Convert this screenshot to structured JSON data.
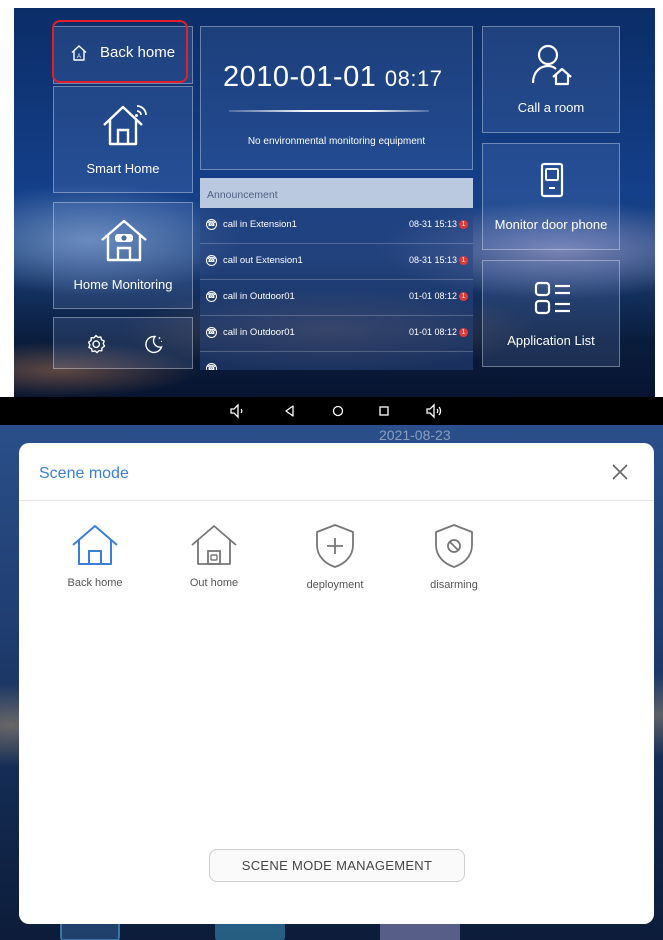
{
  "top": {
    "back_home_label": "Back home",
    "smart_home_label": "Smart Home",
    "home_monitoring_label": "Home Monitoring",
    "date": "2010-01-01",
    "time": "08:17",
    "env_message": "No environmental monitoring equipment",
    "announcement_header": "Announcement",
    "announcements": [
      {
        "text": "call in Extension1",
        "time": "08-31 15:13",
        "badge": "1"
      },
      {
        "text": "call out Extension1",
        "time": "08-31 15:13",
        "badge": "1"
      },
      {
        "text": "call in Outdoor01",
        "time": "01-01 08:12",
        "badge": "1"
      },
      {
        "text": "call in Outdoor01",
        "time": "01-01 08:12",
        "badge": "1"
      }
    ],
    "call_room_label": "Call a room",
    "monitor_label": "Monitor door phone",
    "app_list_label": "Application List",
    "highlight_color": "#e1202c"
  },
  "bottom": {
    "background_date": "2021-08-23",
    "dialog_title": "Scene mode",
    "scenes": [
      {
        "label": "Back home",
        "icon": "home-icon",
        "active": true
      },
      {
        "label": "Out home",
        "icon": "home-lock-icon",
        "active": false
      },
      {
        "label": "deployment",
        "icon": "shield-plus-icon",
        "active": false
      },
      {
        "label": "disarming",
        "icon": "shield-forbidden-icon",
        "active": false
      }
    ],
    "management_button": "SCENE MODE MANAGEMENT",
    "accent_color": "#3b7fd6"
  }
}
